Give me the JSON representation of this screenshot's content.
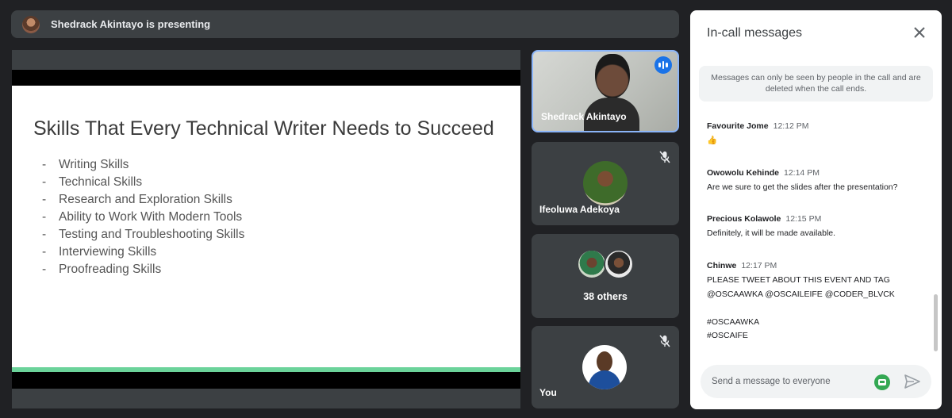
{
  "banner": {
    "text": "Shedrack Akintayo is presenting"
  },
  "slide": {
    "title": "Skills That Every Technical Writer Needs to Succeed",
    "bullets": [
      "Writing Skills",
      "Technical Skills",
      "Research and Exploration Skills",
      "Ability to Work With Modern Tools",
      "Testing and Troubleshooting Skills",
      "Interviewing Skills",
      "Proofreading Skills"
    ]
  },
  "tiles": {
    "presenter": {
      "name": "Shedrack Akintayo",
      "icon": "speaking-indicator-icon"
    },
    "participant": {
      "name": "Ifeoluwa Adekoya",
      "icon": "mic-off-icon"
    },
    "others": {
      "label": "38 others"
    },
    "self": {
      "name": "You",
      "icon": "mic-off-icon"
    }
  },
  "chat": {
    "title": "In-call messages",
    "notice": "Messages can only be seen by people in the call and are deleted when the call ends.",
    "messages": [
      {
        "sender": "Favourite Jome",
        "time": "12:12 PM",
        "body": "👍"
      },
      {
        "sender": "Owowolu Kehinde",
        "time": "12:14 PM",
        "body": "Are we sure to get the slides after the presentation?"
      },
      {
        "sender": "Precious Kolawole",
        "time": "12:15 PM",
        "body": "Definitely, it will be made available."
      },
      {
        "sender": "Chinwe",
        "time": "12:17 PM",
        "body": "PLEASE TWEET ABOUT THIS EVENT AND TAG\n@OSCAAWKA @OSCAILEIFE @CODER_BLVCK\n\n#OSCAAWKA\n#OSCAIFE"
      }
    ],
    "input_placeholder": "Send a message to everyone"
  },
  "colors": {
    "accent": "#1a73e8",
    "highlight_border": "#8ab4f8",
    "slide_stripe": "#6bd39a",
    "background": "#202124"
  }
}
